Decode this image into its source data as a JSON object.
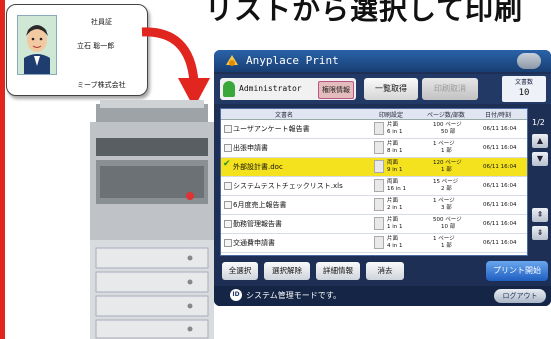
{
  "heading": "リストから選択して印刷",
  "card": {
    "title": "社員証",
    "name": "立石 聡一郎",
    "company": "ミーブ株式会社"
  },
  "screen": {
    "app_title": "Anyplace Print",
    "user_name": "Administrator",
    "admin_label": "権限情報",
    "fetch_label": "一覧取得",
    "cancel_fetch_label": "印刷取消",
    "doc_count_label": "文書数",
    "doc_count_value": "10",
    "headers": [
      "文書名",
      "印刷設定",
      "ページ数/部数",
      "日付/時刻"
    ],
    "rows": [
      {
        "name": "ユーザアンケート報告書",
        "set1": "片面",
        "set2": "6 in 1",
        "pages": "100 ページ",
        "copies": "50 部",
        "date": "06/11 16:04",
        "selected": false
      },
      {
        "name": "出張申請書",
        "set1": "片面",
        "set2": "8 in 1",
        "pages": "1 ページ",
        "copies": "1 部",
        "date": "06/11 16:04",
        "selected": false
      },
      {
        "name": "外部設計書.doc",
        "set1": "両面",
        "set2": "9 in 1",
        "pages": "120 ページ",
        "copies": "1 部",
        "date": "06/11 16:04",
        "selected": true
      },
      {
        "name": "システムテストチェックリスト.xls",
        "set1": "両面",
        "set2": "16 in 1",
        "pages": "15 ページ",
        "copies": "2 部",
        "date": "06/11 16:04",
        "selected": false
      },
      {
        "name": "6月度売上報告書",
        "set1": "片面",
        "set2": "2 in 1",
        "pages": "1 ページ",
        "copies": "3 部",
        "date": "06/11 16:04",
        "selected": false
      },
      {
        "name": "勤務管理報告書",
        "set1": "片面",
        "set2": "1 in 1",
        "pages": "500 ページ",
        "copies": "10 部",
        "date": "06/11 16:04",
        "selected": false
      },
      {
        "name": "交通費申請書",
        "set1": "片面",
        "set2": "4 in 1",
        "pages": "1 ページ",
        "copies": "1 部",
        "date": "06/11 16:04",
        "selected": false
      }
    ],
    "page_indicator": "1/2",
    "buttons": {
      "select_all": "全選択",
      "deselect": "選択解除",
      "detail": "詳細情報",
      "delete": "消去",
      "print": "プリント開始"
    },
    "status_text": "システム管理モードです。",
    "status_icon_text": "ID",
    "logout": "ログアウト"
  },
  "colors": {
    "accent_red": "#e0261f",
    "screen_bg": "#1e2f55",
    "selected_row": "#f5e21f",
    "print_button": "#1e5ec0"
  }
}
